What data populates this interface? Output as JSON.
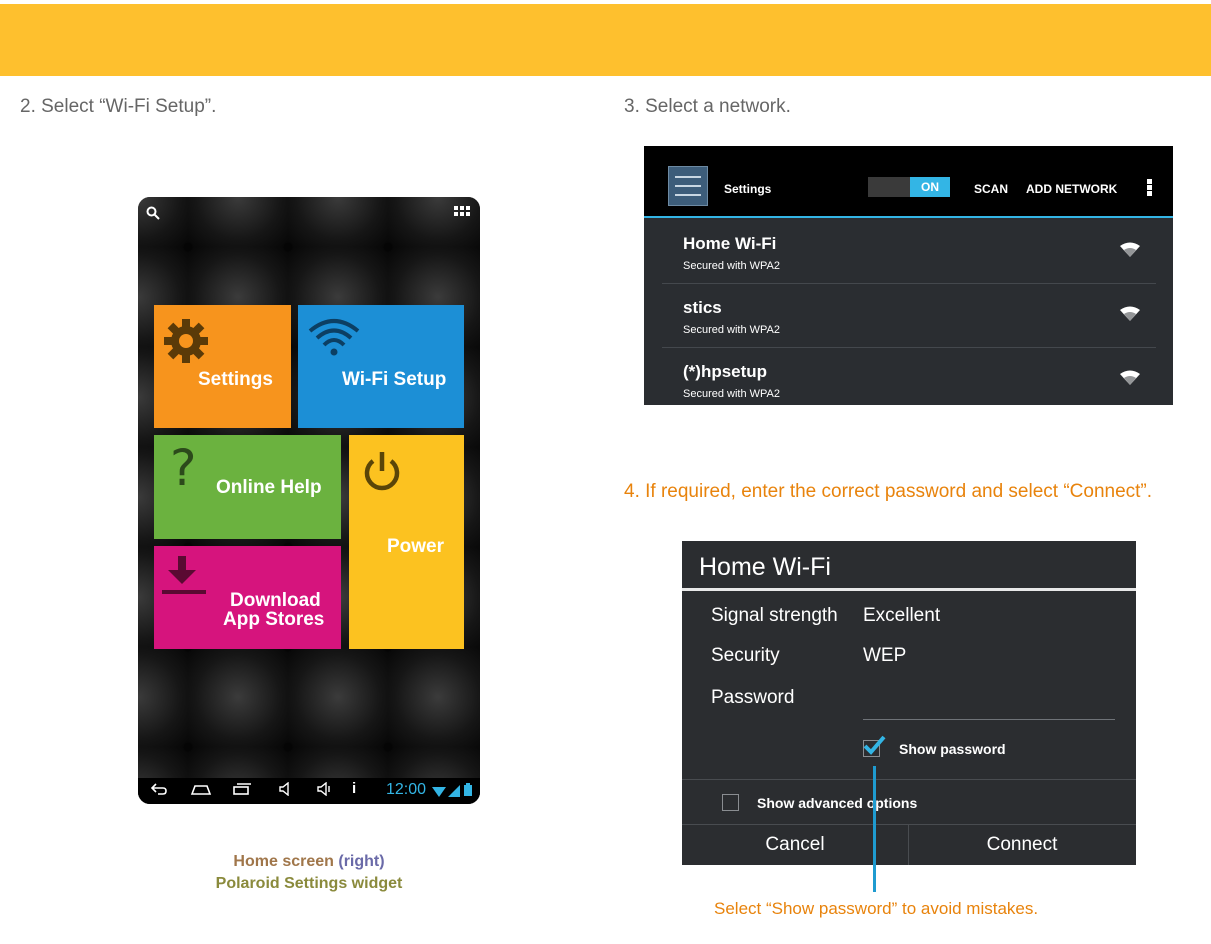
{
  "colors": {
    "banner": "#fec02e",
    "step_text": "#666666",
    "step_orange": "#e8830c",
    "accent_blue": "#33b5e5",
    "callout": "#1f9bd0"
  },
  "steps": {
    "step2": "2. Select “Wi-Fi Setup”.",
    "step3": "3. Select a network.",
    "step4": "4. If required, enter the correct password and select “Connect”."
  },
  "tablet": {
    "search_icon": "search-icon",
    "apps_icon": "apps-grid-icon",
    "tiles": [
      {
        "label": "Settings",
        "icon": "gear-icon",
        "color": "#f7941d"
      },
      {
        "label": "Wi-Fi Setup",
        "icon": "wifi-icon",
        "color": "#1c8fd6"
      },
      {
        "label": "Online Help",
        "icon": "question-icon",
        "color": "#6bb23f"
      },
      {
        "label": "Power",
        "icon": "power-icon",
        "color": "#fcc220"
      },
      {
        "label_line1": "Download",
        "label_line2": "App Stores",
        "icon": "download-icon",
        "color": "#d6147d"
      }
    ],
    "navbar": {
      "time": "12:00",
      "icons": [
        "back-icon",
        "home-icon",
        "recent-apps-icon",
        "volume-down-icon",
        "volume-up-icon",
        "info-icon",
        "wifi-status-icon",
        "battery-icon"
      ]
    }
  },
  "caption": {
    "part1": "Home screen",
    "part2": "(right)",
    "part3": "Polaroid Settings widget"
  },
  "network_panel": {
    "title": "Settings",
    "toggle": "ON",
    "scan": "SCAN",
    "add_network": "ADD NETWORK",
    "networks": [
      {
        "name": "Home Wi-Fi",
        "security": "Secured with WPA2"
      },
      {
        "name": "stics",
        "security": "Secured with WPA2"
      },
      {
        "name": "(*)hpsetup",
        "security": "Secured with WPA2"
      }
    ]
  },
  "dialog": {
    "title": "Home Wi-Fi",
    "signal_label": "Signal strength",
    "signal_value": "Excellent",
    "security_label": "Security",
    "security_value": "WEP",
    "password_label": "Password",
    "show_password": "Show password",
    "show_password_checked": true,
    "show_advanced": "Show advanced options",
    "show_advanced_checked": false,
    "cancel": "Cancel",
    "connect": "Connect"
  },
  "callout": "Select “Show password” to avoid mistakes."
}
